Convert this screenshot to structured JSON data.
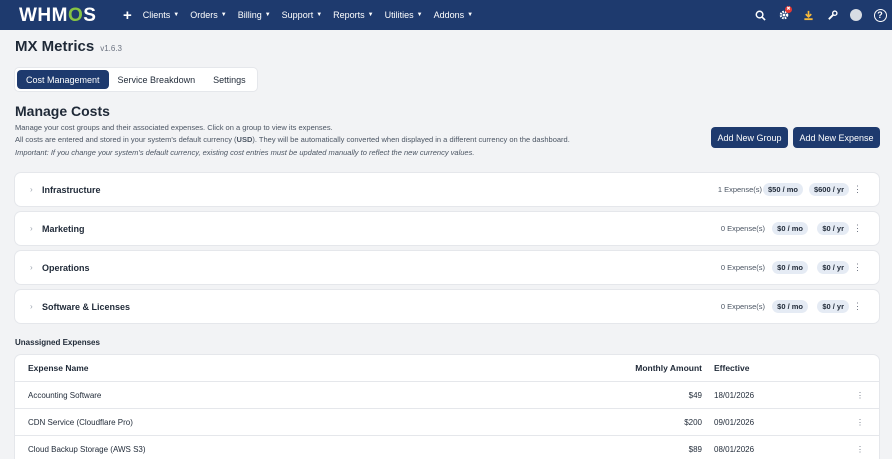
{
  "app": {
    "logo": {
      "pre": "WHM",
      "o": "O",
      "post": "S"
    },
    "nav": [
      {
        "label": "Clients"
      },
      {
        "label": "Orders"
      },
      {
        "label": "Billing"
      },
      {
        "label": "Support"
      },
      {
        "label": "Reports"
      },
      {
        "label": "Utilities"
      },
      {
        "label": "Addons"
      }
    ],
    "notification_badge": "✖"
  },
  "page": {
    "title": "MX Metrics",
    "version": "v1.6.3",
    "tabs": [
      {
        "label": "Cost Management",
        "active": true
      },
      {
        "label": "Service Breakdown",
        "active": false
      },
      {
        "label": "Settings",
        "active": false
      }
    ]
  },
  "manage": {
    "title": "Manage Costs",
    "desc1": "Manage your cost groups and their associated expenses. Click on a group to view its expenses.",
    "desc2_pre": "All costs are entered and stored in your system's default currency (",
    "desc2_cur": "USD",
    "desc2_post": "). They will be automatically converted when displayed in a different currency on the dashboard.",
    "desc3": "Important: If you change your system's default currency, existing cost entries must be updated manually to reflect the new currency values.",
    "add_group": "Add New Group",
    "add_expense": "Add New Expense"
  },
  "groups": [
    {
      "name": "Infrastructure",
      "count": "1 Expense(s)",
      "monthly": "$50 / mo",
      "yearly": "$600 / yr"
    },
    {
      "name": "Marketing",
      "count": "0 Expense(s)",
      "monthly": "$0 / mo",
      "yearly": "$0 / yr"
    },
    {
      "name": "Operations",
      "count": "0 Expense(s)",
      "monthly": "$0 / mo",
      "yearly": "$0 / yr"
    },
    {
      "name": "Software & Licenses",
      "count": "0 Expense(s)",
      "monthly": "$0 / mo",
      "yearly": "$0 / yr"
    }
  ],
  "unassigned": {
    "title": "Unassigned Expenses",
    "columns": {
      "name": "Expense Name",
      "amount": "Monthly Amount",
      "effective": "Effective"
    },
    "rows": [
      {
        "name": "Accounting Software",
        "amount": "$49",
        "effective": "18/01/2026"
      },
      {
        "name": "CDN Service (Cloudflare Pro)",
        "amount": "$200",
        "effective": "09/01/2026"
      },
      {
        "name": "Cloud Backup Storage (AWS S3)",
        "amount": "$89",
        "effective": "08/01/2026"
      }
    ]
  },
  "colors": {
    "primary": "#1e3a6e",
    "accent": "#86c443",
    "badge": "#e53935"
  }
}
